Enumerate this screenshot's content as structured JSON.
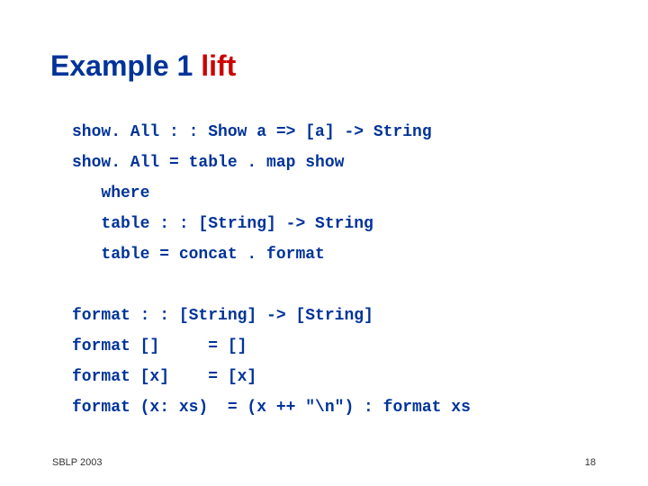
{
  "title": {
    "prefix": "Example 1 ",
    "highlight": "lift"
  },
  "code": {
    "l1": "show. All : : Show a => [a] -> String",
    "l2": "show. All = table . map show",
    "l3": "   where",
    "l4": "   table : : [String] -> String",
    "l5": "   table = concat . format",
    "gap1": "",
    "l6": "format : : [String] -> [String]",
    "l7": "format []     = []",
    "l8": "format [x]    = [x]",
    "l9": "format (x: xs)  = (x ++ \"\\n\") : format xs"
  },
  "footer": {
    "left": "SBLP 2003",
    "page": "18"
  }
}
